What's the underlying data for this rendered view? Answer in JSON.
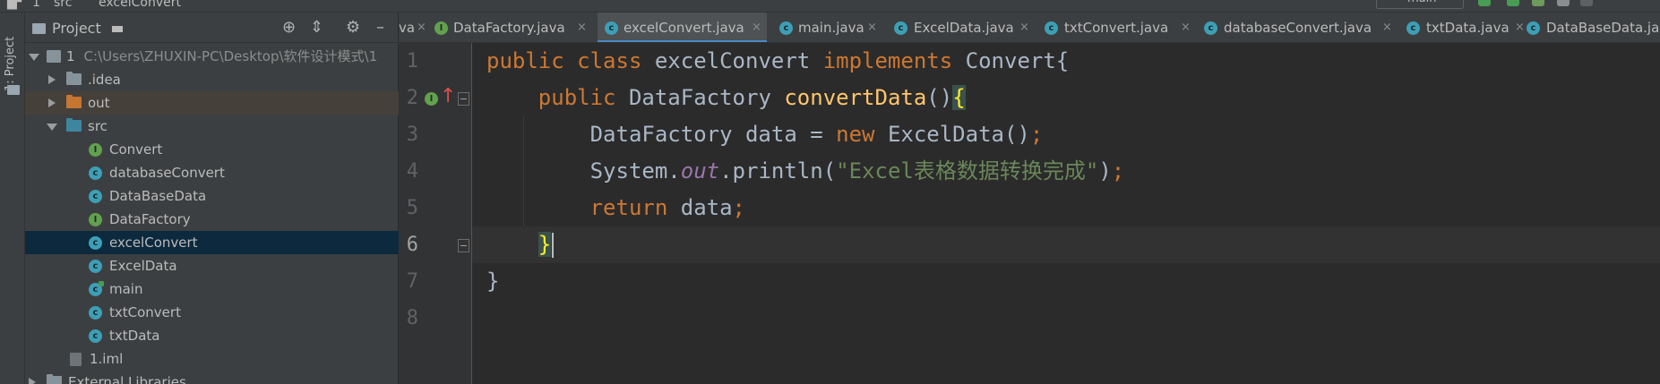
{
  "topbar": {
    "crumb_project": "1",
    "crumb_src": "src",
    "crumb_file": "excelConvert",
    "run_config": "main"
  },
  "toolstrip": {
    "project_tool_label": "1: Project"
  },
  "project_panel": {
    "title": "Project",
    "tree": [
      {
        "label": "1",
        "path": "C:\\Users\\ZHUXIN-PC\\Desktop\\软件设计模式\\1",
        "kind": "module",
        "expanded": true
      },
      {
        "label": ".idea",
        "kind": "folder",
        "color": "#87939a",
        "expanded": false
      },
      {
        "label": "out",
        "kind": "folder",
        "color": "#c57633",
        "expanded": false
      },
      {
        "label": "src",
        "kind": "folder",
        "color": "#3e86a0",
        "expanded": true
      },
      {
        "label": "Convert",
        "kind": "interface",
        "icon_letter": "I"
      },
      {
        "label": "databaseConvert",
        "kind": "class",
        "icon_letter": "c"
      },
      {
        "label": "DataBaseData",
        "kind": "class",
        "icon_letter": "c"
      },
      {
        "label": "DataFactory",
        "kind": "interface",
        "icon_letter": "I"
      },
      {
        "label": "excelConvert",
        "kind": "class",
        "icon_letter": "c",
        "selected": true
      },
      {
        "label": "ExcelData",
        "kind": "class",
        "icon_letter": "c"
      },
      {
        "label": "main",
        "kind": "main-class",
        "icon_letter": "c"
      },
      {
        "label": "txtConvert",
        "kind": "class",
        "icon_letter": "c"
      },
      {
        "label": "txtData",
        "kind": "class",
        "icon_letter": "c"
      },
      {
        "label": "1.iml",
        "kind": "iml"
      },
      {
        "label": "External Libraries",
        "kind": "library"
      }
    ]
  },
  "tabs": [
    {
      "label": "va",
      "kind": "partial"
    },
    {
      "label": "DataFactory.java",
      "kind": "interface",
      "icon_letter": "I"
    },
    {
      "label": "excelConvert.java",
      "kind": "class",
      "icon_letter": "c",
      "active": true
    },
    {
      "label": "main.java",
      "kind": "class",
      "icon_letter": "c"
    },
    {
      "label": "ExcelData.java",
      "kind": "class",
      "icon_letter": "c"
    },
    {
      "label": "txtConvert.java",
      "kind": "class",
      "icon_letter": "c"
    },
    {
      "label": "databaseConvert.java",
      "kind": "class",
      "icon_letter": "c"
    },
    {
      "label": "txtData.java",
      "kind": "class",
      "icon_letter": "c"
    },
    {
      "label": "DataBaseData.java",
      "kind": "class",
      "icon_letter": "c"
    }
  ],
  "tab_close_glyph": "×",
  "editor": {
    "line_numbers": [
      "1",
      "2",
      "3",
      "4",
      "5",
      "6",
      "7",
      "8"
    ],
    "current_line": 6,
    "lines": [
      [
        [
          "kw",
          "public class "
        ],
        [
          "plain",
          "excelConvert "
        ],
        [
          "kw",
          "implements "
        ],
        [
          "plain",
          "Convert{"
        ]
      ],
      [
        [
          "plain",
          "    "
        ],
        [
          "kw",
          "public "
        ],
        [
          "plain",
          "DataFactory "
        ],
        [
          "fn",
          "convertData"
        ],
        [
          "plain",
          "()"
        ],
        [
          "brm",
          "{"
        ]
      ],
      [
        [
          "plain",
          "        DataFactory data = "
        ],
        [
          "kw",
          "new "
        ],
        [
          "plain",
          "ExcelData()"
        ],
        [
          "kw",
          ";"
        ]
      ],
      [
        [
          "plain",
          "        System."
        ],
        [
          "fld",
          "out"
        ],
        [
          "plain",
          ".println("
        ],
        [
          "st",
          "\"Excel表格数据转换完成\""
        ],
        [
          "plain",
          ")"
        ],
        [
          "kw",
          ";"
        ]
      ],
      [
        [
          "plain",
          "        "
        ],
        [
          "kw",
          "return "
        ],
        [
          "plain",
          "data"
        ],
        [
          "kw",
          ";"
        ]
      ],
      [
        [
          "plain",
          "    "
        ],
        [
          "brm",
          "}"
        ],
        [
          "caret",
          ""
        ]
      ],
      [
        [
          "plain",
          "}"
        ]
      ],
      []
    ]
  },
  "colors": {
    "keyword": "#cc7832",
    "function": "#ffc66d",
    "string": "#6a8759",
    "static_field": "#9876aa",
    "text": "#a9b7c6",
    "selection": "#0d293e",
    "active_tab_underline": "#4a88c7"
  }
}
